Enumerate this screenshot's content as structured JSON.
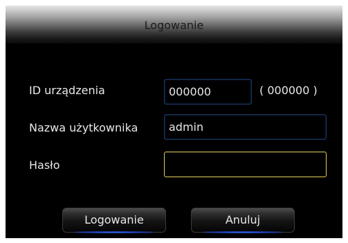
{
  "dialog": {
    "title": "Logowanie"
  },
  "form": {
    "device_id": {
      "label": "ID urządzenia",
      "value": "000000",
      "hint": "( 000000 )"
    },
    "username": {
      "label": "Nazwa użytkownika",
      "value": "admin"
    },
    "password": {
      "label": "Hasło",
      "value": ""
    }
  },
  "buttons": {
    "login": "Logowanie",
    "cancel": "Anuluj"
  },
  "colors": {
    "background": "#000000",
    "focus_border": "#e6d255",
    "field_border": "#1c3a66",
    "button_glow": "#3a78ff"
  }
}
